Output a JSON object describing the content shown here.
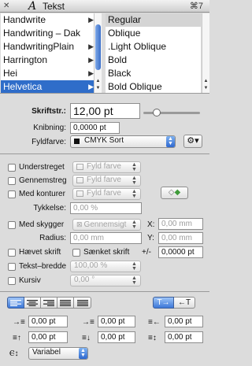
{
  "titlebar": {
    "close": "✕",
    "glyph": "A",
    "title": "Tekst",
    "shortcut": "⌘7"
  },
  "fonts": [
    {
      "label": "Handwrite",
      "arrow": "▶"
    },
    {
      "label": "Handwriting – Dak",
      "arrow": ""
    },
    {
      "label": "HandwritingPlain",
      "arrow": "▶"
    },
    {
      "label": "Harrington",
      "arrow": "▶"
    },
    {
      "label": "Hei",
      "arrow": "▶"
    },
    {
      "label": "Helvetica",
      "arrow": "▶"
    }
  ],
  "styles": [
    "Regular",
    "Oblique",
    ".Light Oblique",
    "Bold",
    "Black",
    "Bold Oblique"
  ],
  "size": {
    "label": "Skriftstr.:",
    "value": "12,00 pt",
    "slider_fraction": 0.08
  },
  "kerning": {
    "label": "Knibning:",
    "value": "0,0000 pt"
  },
  "fill": {
    "label": "Fyldfarve:",
    "value": "CMYK Sort",
    "swatch": "#111111"
  },
  "understreget": {
    "label": "Understreget",
    "popup": "Fyld farve"
  },
  "gennemstreg": {
    "label": "Gennemstreg",
    "popup": "Fyld farve"
  },
  "konturer": {
    "label": "Med konturer",
    "popup": "Fyld farve"
  },
  "tykkelse": {
    "label": "Tykkelse:",
    "value": "0,00 %"
  },
  "skygger": {
    "label": "Med skygger",
    "popup": "Gennemsigt"
  },
  "radius": {
    "label": "Radius:",
    "value": "0,00 mm"
  },
  "x": {
    "label": "X:",
    "value": "0,00 mm"
  },
  "y": {
    "label": "Y:",
    "value": "0,00 mm"
  },
  "haevet": {
    "label": "Hævet skrift"
  },
  "saenket": {
    "label": "Sænket skrift"
  },
  "plusminus": {
    "label": "+/-",
    "value": "0,0000 pt"
  },
  "bredde": {
    "label": "Tekst–bredde",
    "value": "100,00 %"
  },
  "kursiv": {
    "label": "Kursiv",
    "value": "0,00 °"
  },
  "spacing": [
    "0,00 pt",
    "0,00 pt",
    "0,00 pt",
    "0,00 pt",
    "0,00 pt",
    "0,00 pt"
  ],
  "linespacing": {
    "value": "Variabel"
  },
  "direction": {
    "ltr": "T→",
    "rtl": "←T"
  }
}
